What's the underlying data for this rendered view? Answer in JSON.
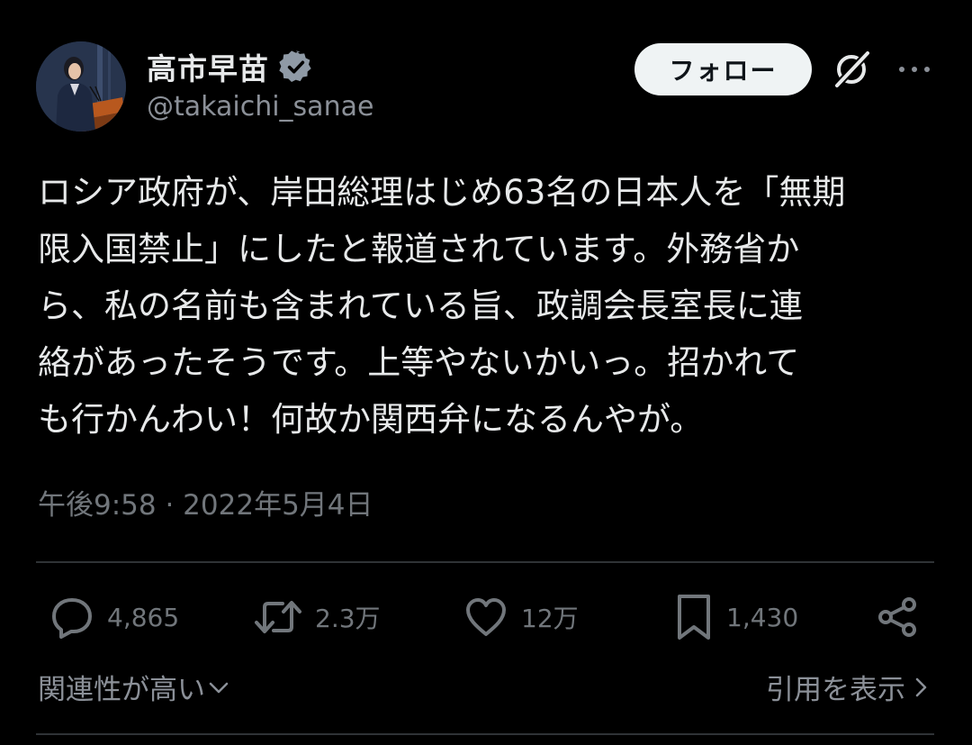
{
  "author": {
    "display_name": "高市早苗",
    "handle": "@takaichi_sanae",
    "verified_icon": "verified-badge",
    "badge_color": "#8f9aa6"
  },
  "header": {
    "follow_label": "フォロー",
    "grok_icon": "grok-icon",
    "more_icon": "more-horizontal-icon"
  },
  "tweet": {
    "lines": [
      "ロシア政府が、岸田総理はじめ63名の日本人を「無期",
      "限入国禁止」にしたと報道されています。外務省か",
      "ら、私の名前も含まれている旨、政調会長室長に連",
      "絡があったそうです。上等やないかいっ。招かれて",
      "も行かんわい！何故か関西弁になるんやが。"
    ],
    "timestamp": "午後9:58 · 2022年5月4日"
  },
  "actions": {
    "reply": {
      "icon": "reply-icon",
      "count": "4,865"
    },
    "retweet": {
      "icon": "retweet-icon",
      "count": "2.3万"
    },
    "like": {
      "icon": "heart-icon",
      "count": "12万"
    },
    "bookmark": {
      "icon": "bookmark-icon",
      "count": "1,430"
    },
    "share": {
      "icon": "share-icon"
    }
  },
  "footer": {
    "sort_label": "関連性が高い",
    "quotes_label": "引用を表示"
  },
  "colors": {
    "background": "#000000",
    "text": "#e7e9ea",
    "muted": "#71767b",
    "divider": "#2f3336",
    "follow_bg": "#eff3f4"
  }
}
